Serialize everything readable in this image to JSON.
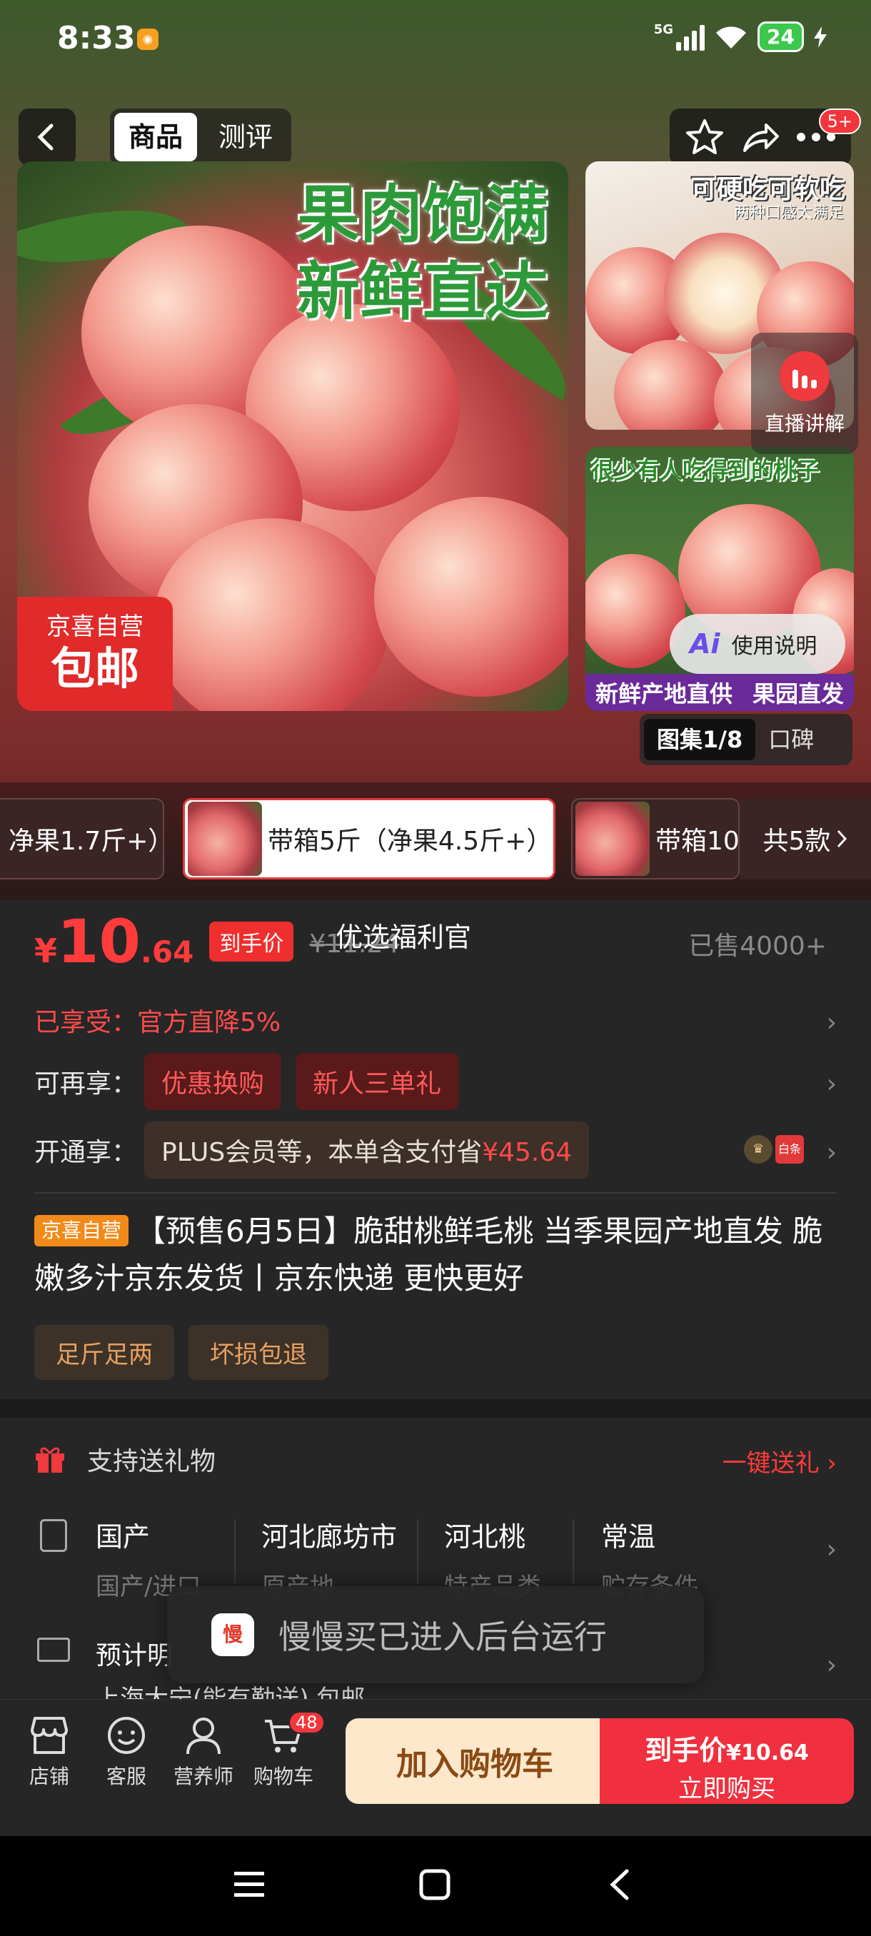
{
  "status": {
    "time": "8:33",
    "network": "5G",
    "battery": "24"
  },
  "header": {
    "tabs": [
      "商品",
      "测评"
    ],
    "badge": "5+"
  },
  "gallery": {
    "slogan_line1": "果肉饱满",
    "slogan_line2": "新鲜直达",
    "ship_tag_top": "京喜自营",
    "ship_tag_bottom": "包邮",
    "side1_caption": "可硬吃可软吃",
    "side1_subcaption": "两种口感太满足",
    "side2_caption": "很少有人吃得到的桃子",
    "side2_bottom_left": "新鲜产地直供",
    "side2_bottom_right": "果园直发",
    "live_label": "直播讲解",
    "ai_label": "使用说明",
    "tabs": [
      "图集1/8",
      "口碑"
    ]
  },
  "variants": {
    "items": [
      "净果1.7斤+）",
      "带箱5斤（净果4.5斤+）",
      "带箱10斤"
    ],
    "more": "共5款"
  },
  "price": {
    "symbol": "¥",
    "integer": "10",
    "decimal": ".64",
    "badge": "到手价",
    "original": "¥11.24",
    "welfare": "优选福利官",
    "sold": "已售4000+"
  },
  "promos": {
    "enjoyed_label": "已享受：",
    "enjoyed_value": "官方直降5%",
    "more_label": "可再享：",
    "more_chips": [
      "优惠换购",
      "新人三单礼"
    ],
    "open_label": "开通享：",
    "plus_text": "PLUS会员等，本单含支付省",
    "plus_amount": "¥45.64",
    "icon_bt": "白条"
  },
  "product": {
    "tag": "京喜自营",
    "title": "【预售6月5日】脆甜桃鲜毛桃 当季果园产地直发 脆嫩多汁京东发货丨京东快递 更快更好",
    "tags": [
      "足斤足两",
      "坏损包退"
    ]
  },
  "service": {
    "gift_label": "支持送礼物",
    "gift_link": "一键送礼",
    "attributes": [
      {
        "value": "国产",
        "key": "国产/进口"
      },
      {
        "value": "河北廊坊市",
        "key": "原产地"
      },
      {
        "value": "河北桃",
        "key": "特产品类"
      },
      {
        "value": "常温",
        "key": "贮存条件"
      }
    ],
    "ship_label": "预计明",
    "ship_addr": "上海大宁(能有勤送) 包邮"
  },
  "toast": {
    "icon_text": "慢",
    "text": "慢慢买已进入后台运行"
  },
  "bottom": {
    "items": [
      "店铺",
      "客服",
      "营养师",
      "购物车"
    ],
    "cart_badge": "48",
    "add_cart": "加入购物车",
    "buy_line1_prefix": "到手价",
    "buy_line1_price": "¥10.64",
    "buy_line2": "立即购买"
  },
  "colors": {
    "accent": "#f0303e",
    "tag_orange": "#f28a1a",
    "plus_gold": "#e8a060"
  }
}
